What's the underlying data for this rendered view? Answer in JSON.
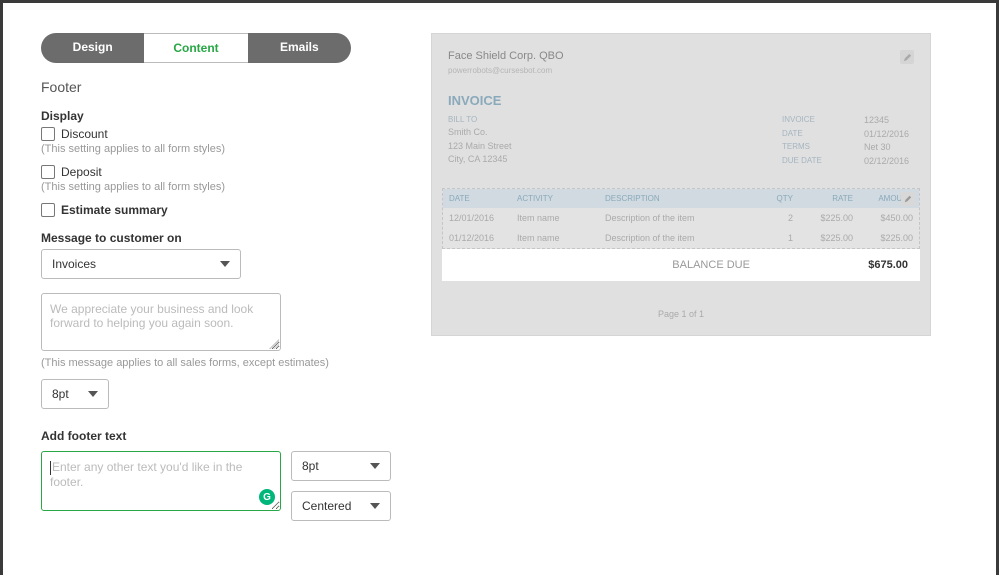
{
  "tabs": {
    "design": "Design",
    "content": "Content",
    "emails": "Emails"
  },
  "section": "Footer",
  "display": {
    "heading": "Display",
    "discount": "Discount",
    "discount_help": "(This setting applies to all form styles)",
    "deposit": "Deposit",
    "deposit_help": "(This setting applies to all form styles)",
    "estimate": "Estimate summary"
  },
  "message": {
    "heading": "Message to customer on",
    "select_value": "Invoices",
    "placeholder": "We appreciate your business and look forward to helping you again soon.",
    "helper": "(This message applies to all sales forms, except estimates)",
    "font": "8pt"
  },
  "footer_text": {
    "heading": "Add footer text",
    "placeholder": "Enter any other text you'd like in the footer.",
    "font": "8pt",
    "align": "Centered"
  },
  "preview": {
    "company": "Face Shield Corp. QBO",
    "email": "powerrobots@cursesbot.com",
    "doc_title": "INVOICE",
    "bill_to_label": "BILL TO",
    "bill_to": [
      "Smith Co.",
      "123 Main Street",
      "City, CA 12345"
    ],
    "meta": [
      {
        "k": "INVOICE",
        "v": "12345"
      },
      {
        "k": "DATE",
        "v": "01/12/2016"
      },
      {
        "k": "TERMS",
        "v": "Net 30"
      },
      {
        "k": "DUE DATE",
        "v": "02/12/2016"
      }
    ],
    "columns": {
      "date": "DATE",
      "activity": "ACTIVITY",
      "desc": "DESCRIPTION",
      "qty": "QTY",
      "rate": "RATE",
      "amount": "AMOUNT"
    },
    "rows": [
      {
        "date": "12/01/2016",
        "activity": "Item name",
        "desc": "Description of the item",
        "qty": "2",
        "rate": "$225.00",
        "amount": "$450.00"
      },
      {
        "date": "01/12/2016",
        "activity": "Item name",
        "desc": "Description of the item",
        "qty": "1",
        "rate": "$225.00",
        "amount": "$225.00"
      }
    ],
    "balance_label": "BALANCE DUE",
    "balance_value": "$675.00",
    "page": "Page 1 of 1"
  }
}
